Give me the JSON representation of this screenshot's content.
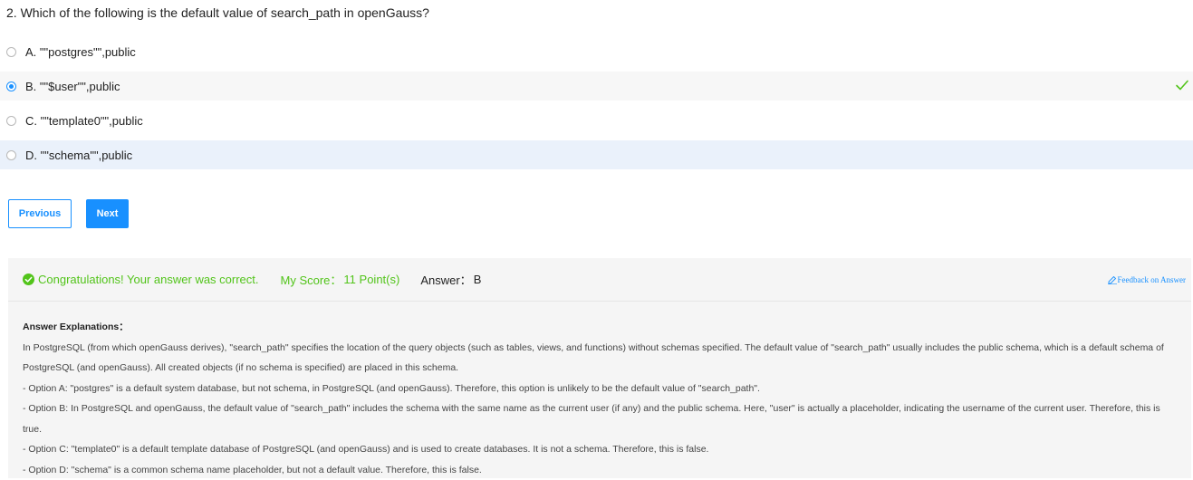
{
  "question": {
    "text": "2. Which of the following is the default value of search_path in openGauss?"
  },
  "options": [
    {
      "label": "A. \"\"postgres\"\",public",
      "selected": false
    },
    {
      "label": "B. \"\"$user\"\",public",
      "selected": true
    },
    {
      "label": "C. \"\"template0\"\",public",
      "selected": false
    },
    {
      "label": "D. \"\"schema\"\",public",
      "selected": false
    }
  ],
  "buttons": {
    "previous": "Previous",
    "next": "Next"
  },
  "result": {
    "congrats": "Congratulations! Your answer was correct.",
    "score_label": "My Score：",
    "score_value": "11 Point(s)",
    "answer_label": "Answer：",
    "answer_value": "B",
    "feedback": "Feedback on Answer"
  },
  "explanation": {
    "title": "Answer Explanations：",
    "lines": [
      "In PostgreSQL (from which openGauss derives), \"search_path\" specifies the location of the query objects (such as tables, views, and functions) without schemas specified. The default value of \"search_path\" usually includes the public schema, which is a default schema of PostgreSQL (and openGauss). All created objects (if no schema is specified) are placed in this schema.",
      "- Option A: \"postgres\" is a default system database, but not schema, in PostgreSQL (and openGauss). Therefore, this option is unlikely to be the default value of \"search_path\".",
      "- Option B: In PostgreSQL and openGauss, the default value of \"search_path\" includes the schema with the same name as the current user (if any) and the public schema. Here, \"user\" is actually a placeholder, indicating the username of the current user. Therefore, this is true.",
      "- Option C: \"template0\" is a default template database of PostgreSQL (and openGauss) and is used to create databases. It is not a schema. Therefore, this is false.",
      "- Option D: \"schema\" is a common schema name placeholder, but not a default value. Therefore, this is false."
    ]
  },
  "colors": {
    "accent": "#1890ff",
    "success": "#52c41a"
  },
  "icons": {
    "correct": "checkmark-icon",
    "ok": "check-circle-icon",
    "feedback": "edit-icon"
  }
}
